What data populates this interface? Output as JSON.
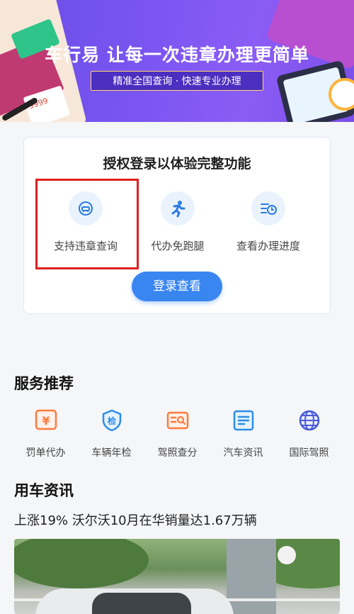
{
  "banner": {
    "title": "车行易 让每一次违章办理更简单",
    "subtitle": "精准全国查询 · 快速专业办理",
    "ticket_text": "9999"
  },
  "auth": {
    "title": "授权登录以体验完整功能",
    "features": [
      {
        "label": "支持违章查询",
        "icon": "car-search-icon"
      },
      {
        "label": "代办免跑腿",
        "icon": "running-man-icon"
      },
      {
        "label": "查看办理进度",
        "icon": "progress-clock-icon"
      }
    ],
    "login_button": "登录查看"
  },
  "services": {
    "title": "服务推荐",
    "items": [
      {
        "label": "罚单代办",
        "icon": "yuan-ticket-icon",
        "color": "#ff7a3d"
      },
      {
        "label": "车辆年检",
        "icon": "inspection-shield-icon",
        "color": "#2a8de8"
      },
      {
        "label": "驾照查分",
        "icon": "license-search-icon",
        "color": "#ff7a3d"
      },
      {
        "label": "汽车资讯",
        "icon": "news-icon",
        "color": "#2a8de8"
      },
      {
        "label": "国际驾照",
        "icon": "globe-icon",
        "color": "#4a5bd8"
      }
    ]
  },
  "news": {
    "title": "用车资讯",
    "headline": "上涨19% 沃尔沃10月在华销量达1.67万辆"
  },
  "colors": {
    "accent": "#3a86f0",
    "highlight": "#e02020",
    "banner": "#7a55f0"
  }
}
